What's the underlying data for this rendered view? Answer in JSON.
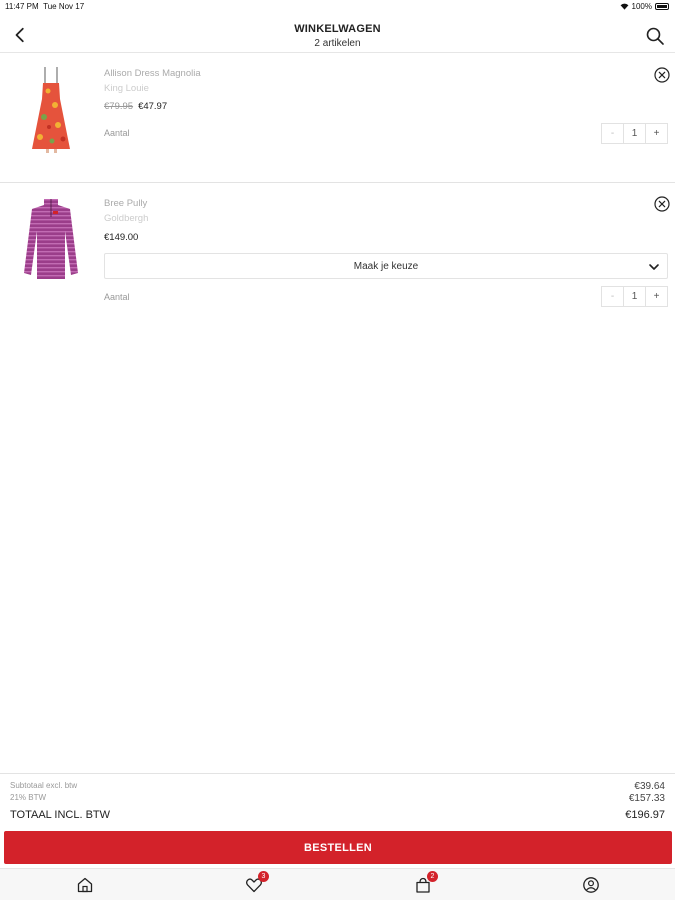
{
  "status_bar": {
    "time": "11:47 PM",
    "date": "Tue Nov 17",
    "battery": "100%"
  },
  "header": {
    "title": "WINKELWAGEN",
    "subtitle": "2 artikelen"
  },
  "items": [
    {
      "name": "Allison Dress Magnolia",
      "brand": "King Louie",
      "old_price": "€79.95",
      "price": "€47.97",
      "qty_label": "Aantal",
      "qty": "1",
      "minus": "-",
      "plus": "+"
    },
    {
      "name": "Bree Pully",
      "brand": "Goldbergh",
      "price": "€149.00",
      "select_label": "Maak je keuze",
      "qty_label": "Aantal",
      "qty": "1",
      "minus": "-",
      "plus": "+"
    }
  ],
  "totals": {
    "subtotal_label": "Subtotaal excl. btw",
    "subtotal_value": "€39.64",
    "vat_label": "21% BTW",
    "vat_value": "€157.33",
    "total_label": "TOTAAL INCL. BTW",
    "total_value": "€196.97"
  },
  "order_button": "BESTELLEN",
  "tabbar": {
    "wishlist_badge": "3",
    "cart_badge": "2"
  },
  "colors": {
    "accent": "#d3222a"
  }
}
